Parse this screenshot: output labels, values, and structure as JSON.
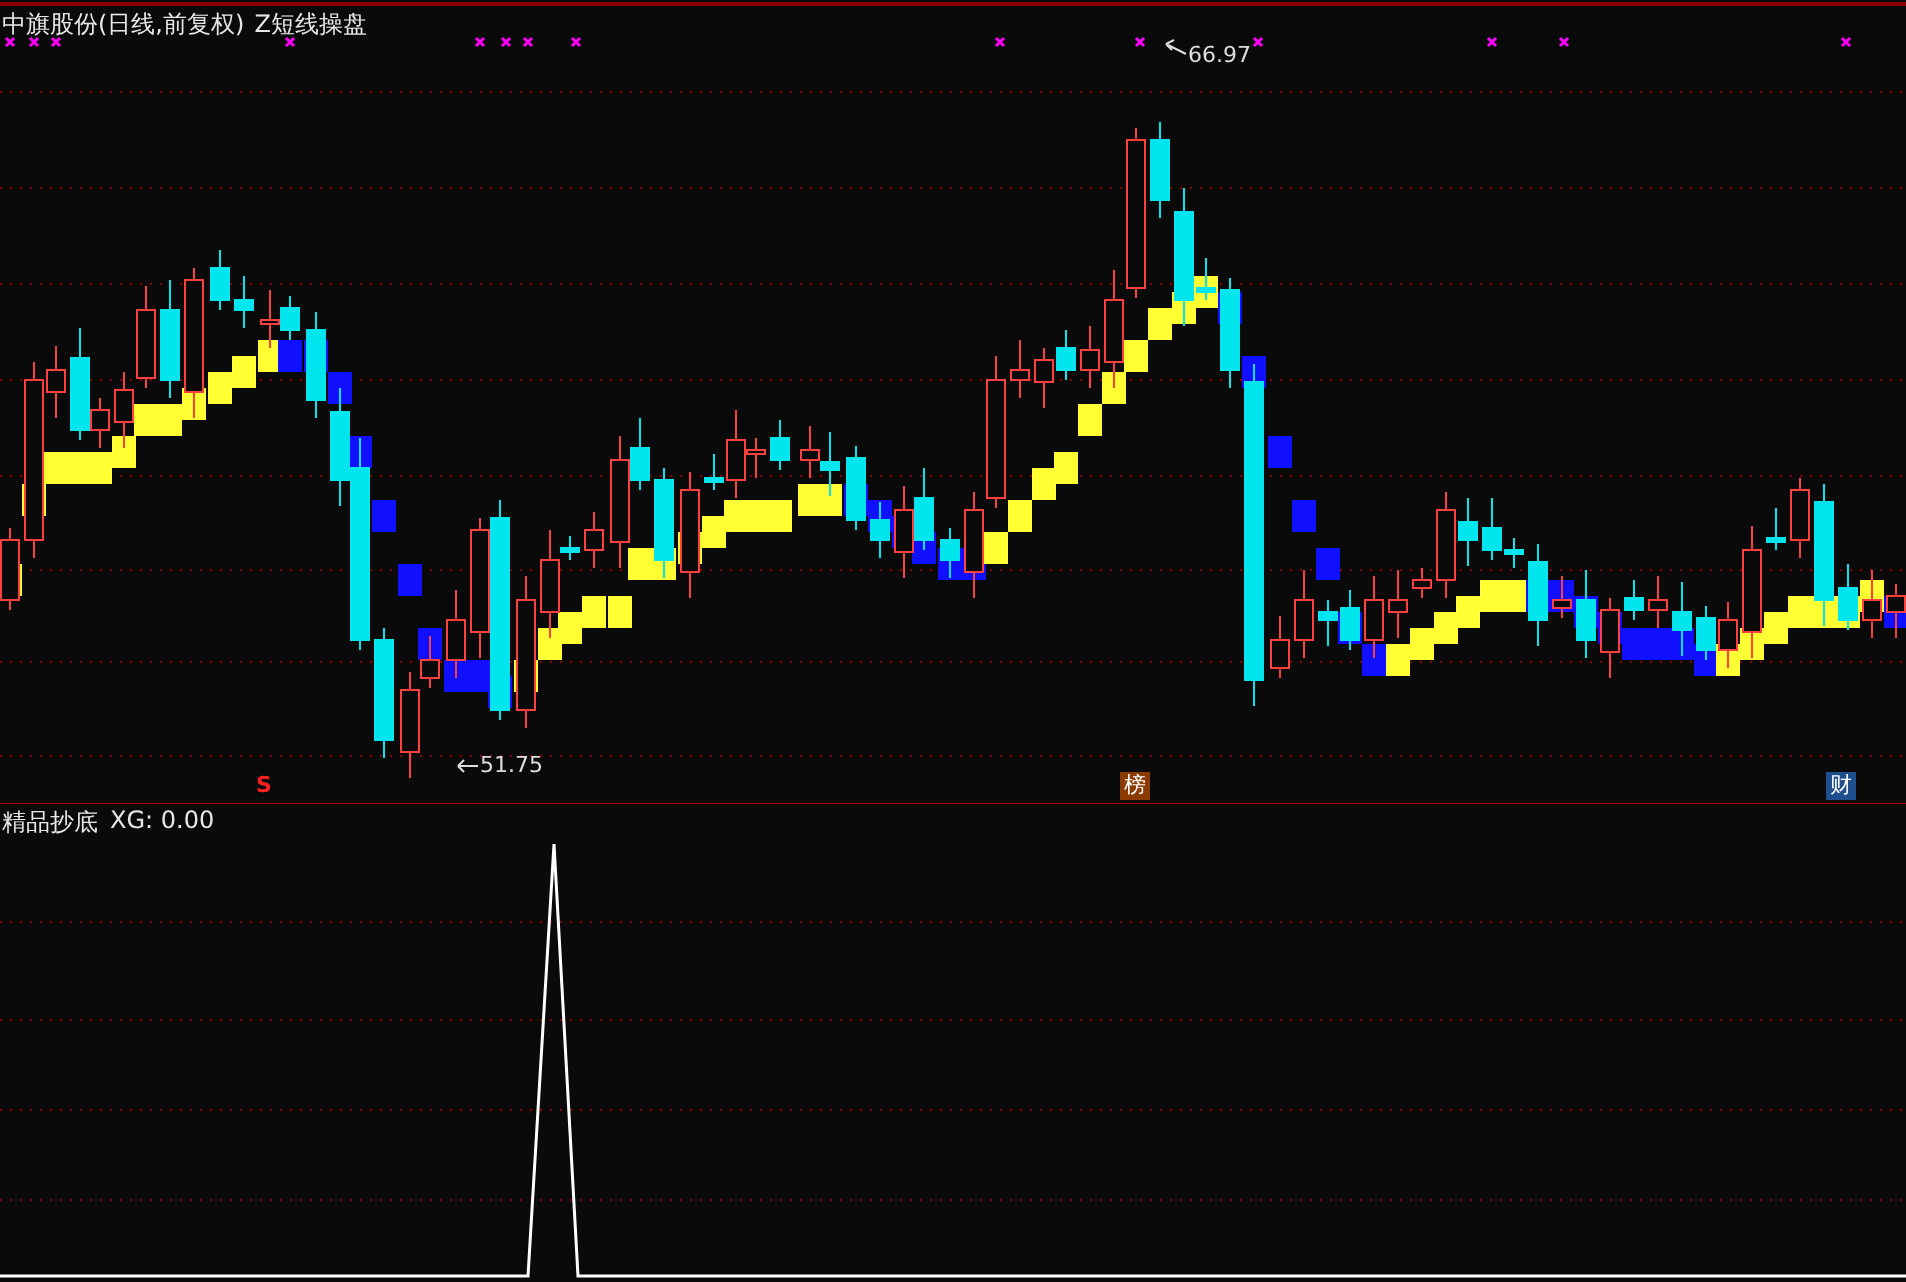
{
  "title": "中旗股份(日线,前复权)",
  "indicator": "Z短线操盘",
  "high_label": "66.97",
  "low_label": "51.75",
  "event_markers": [
    {
      "text": "S",
      "kind": "signal"
    },
    {
      "text": "榜",
      "kind": "list"
    },
    {
      "text": "财",
      "kind": "finance"
    }
  ],
  "lower_pane": {
    "title": "精品抄底",
    "reading": "XG: 0.00"
  }
}
